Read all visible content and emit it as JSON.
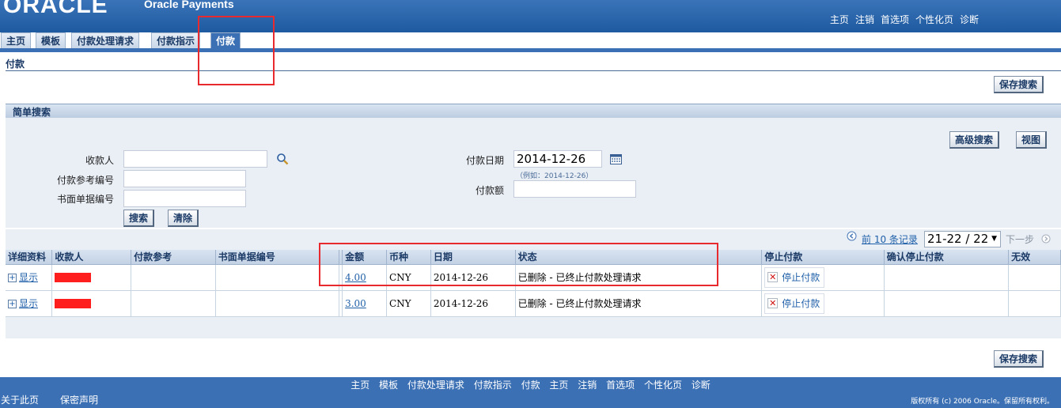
{
  "header": {
    "logo": "ORACLE",
    "app_name": "Oracle Payments",
    "global_links": [
      "主页",
      "注销",
      "首选项",
      "个性化页",
      "诊断"
    ]
  },
  "tabs": [
    "主页",
    "模板",
    "付款处理请求",
    "付款指示",
    "付款"
  ],
  "active_tab": "付款",
  "page_title": "付款",
  "save_search_label": "保存搜索",
  "simple_search": {
    "title": "简单搜索",
    "advanced_label": "高级搜索",
    "view_label": "视图",
    "payee_label": "收款人",
    "payee_value": "",
    "ref_label": "付款参考编号",
    "ref_value": "",
    "paper_label": "书面单据编号",
    "paper_value": "",
    "date_label": "付款日期",
    "date_value": "2014-12-26",
    "date_hint": "（例如：2014-12-26）",
    "amount_label": "付款额",
    "amount_value": "",
    "search_label": "搜索",
    "clear_label": "清除"
  },
  "pager": {
    "prev_label": "前 10 条记录",
    "range": "21-22 / 22",
    "next_label": "下一步"
  },
  "table": {
    "columns": [
      "详细资料",
      "收款人",
      "付款参考",
      "书面单据编号",
      "",
      "金额",
      "币种",
      "日期",
      "状态",
      "停止付款",
      "确认停止付款",
      "无效"
    ],
    "rows": [
      {
        "detail": "显示",
        "payee": "",
        "amount": "4.00",
        "currency": "CNY",
        "date": "2014-12-26",
        "status": "已删除 - 已终止付款处理请求",
        "stop_label": "停止付款"
      },
      {
        "detail": "显示",
        "payee": "",
        "amount": "3.00",
        "currency": "CNY",
        "date": "2014-12-26",
        "status": "已删除 - 已终止付款处理请求",
        "stop_label": "停止付款"
      }
    ]
  },
  "footer": {
    "links": [
      "主页",
      "模板",
      "付款处理请求",
      "付款指示",
      "付款",
      "主页",
      "注销",
      "首选项",
      "个性化页",
      "诊断"
    ],
    "about": "关于此页",
    "privacy": "保密声明",
    "copyright": "版权所有 (c) 2006 Oracle。保留所有权利。"
  },
  "colors": {
    "brand_blue": "#3b70b4",
    "highlight_red": "#e8292d"
  }
}
